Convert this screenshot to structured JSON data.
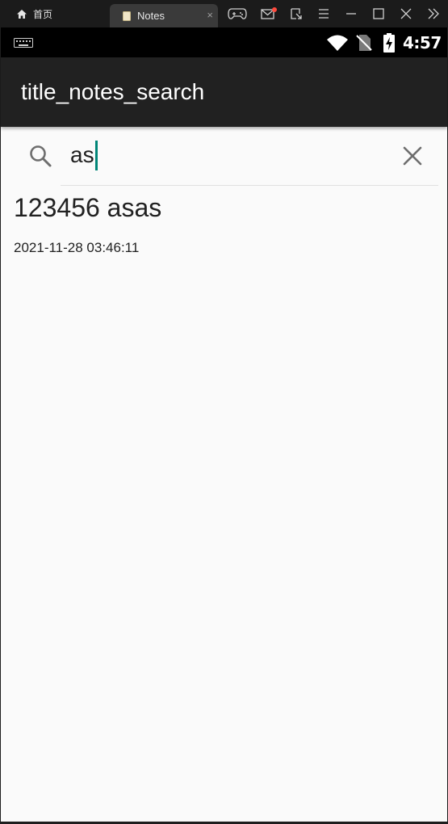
{
  "emulator": {
    "home_tab_label": "首页",
    "active_tab_label": "Notes",
    "close_glyph": "×",
    "icons": [
      "home-icon",
      "document-icon",
      "gamepad-icon",
      "mail-icon",
      "screenshot-icon",
      "menu-icon",
      "minimize-icon",
      "maximize-icon",
      "close-icon",
      "expand-icon"
    ],
    "notification_dot_color": "#ff4a3d"
  },
  "status_bar": {
    "time": "4:57",
    "icons": [
      "keyboard-icon",
      "wifi-icon",
      "no-sim-icon",
      "battery-charging-icon"
    ]
  },
  "toolbar": {
    "title": "title_notes_search"
  },
  "search": {
    "query": "as",
    "icon": "search-icon",
    "clear_icon": "close-icon",
    "caret_color": "#008577"
  },
  "results": [
    {
      "title": "123456 asas",
      "timestamp": "2021-11-28 03:46:11"
    }
  ],
  "colors": {
    "toolbar_bg": "#212121",
    "content_bg": "#fafafa",
    "accent": "#008577"
  }
}
